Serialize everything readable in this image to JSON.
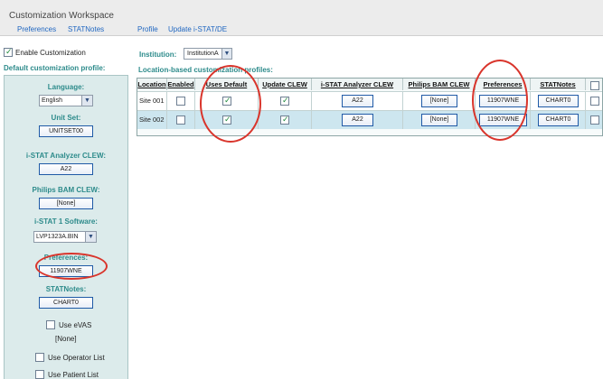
{
  "header": {
    "title": "Customization Workspace",
    "tabs": [
      {
        "label": "Preferences"
      },
      {
        "label": "STATNotes"
      },
      {
        "label": "Profile"
      },
      {
        "label": "Update i-STAT/DE"
      }
    ]
  },
  "sidebar": {
    "enable_label": "Enable Customization",
    "enable_checked": true,
    "default_title": "Default customization profile:",
    "language": {
      "label": "Language:",
      "value": "English"
    },
    "unit_set": {
      "label": "Unit Set:",
      "value": "UNITSET00"
    },
    "istat_clew": {
      "label": "i-STAT Analyzer CLEW:",
      "value": "A22"
    },
    "philips_clew": {
      "label": "Philips BAM CLEW:",
      "value": "[None]"
    },
    "istat1_software": {
      "label": "i-STAT 1 Software:",
      "value": "LVP1323A.BIN"
    },
    "preferences": {
      "label": "Preferences:",
      "value": "11907WNE"
    },
    "statnotes": {
      "label": "STATNotes:",
      "value": "CHART0"
    },
    "use_evas": {
      "label": "Use eVAS",
      "value": "[None]"
    },
    "use_operator_list": {
      "label": "Use Operator List"
    },
    "use_patient_list": {
      "label": "Use Patient List"
    }
  },
  "institution": {
    "label": "Institution:",
    "value": "InstitutionA"
  },
  "location_table": {
    "title": "Location-based customization profiles:",
    "headers": [
      "Location",
      "Enabled",
      "Uses Default",
      "Update CLEW",
      "i-STAT Analyzer CLEW",
      "Philips BAM CLEW",
      "Preferences",
      "STATNotes"
    ],
    "rows": [
      {
        "location": "Site 001",
        "enabled": false,
        "uses_default": true,
        "update_clew": true,
        "istat_clew": "A22",
        "philips_clew": "[None]",
        "preferences": "11907WNE",
        "statnotes": "CHART0"
      },
      {
        "location": "Site 002",
        "enabled": false,
        "uses_default": true,
        "update_clew": true,
        "istat_clew": "A22",
        "philips_clew": "[None]",
        "preferences": "11907WNE",
        "statnotes": "CHART0"
      }
    ]
  },
  "colors": {
    "accent": "#2d8b8b",
    "link": "#1f66c1",
    "annotation": "#d9342b",
    "selected_row": "#cde6ef"
  }
}
